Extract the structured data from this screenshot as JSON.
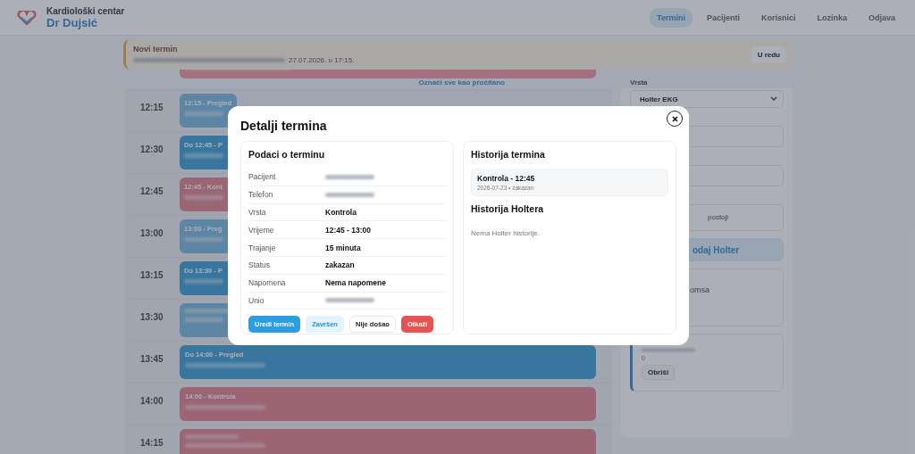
{
  "header": {
    "title": "Kardiološki centar",
    "subtitle": "Dr Dujsić",
    "nav": [
      {
        "label": "Termini",
        "selected": true
      },
      {
        "label": "Pacijenti",
        "selected": false
      },
      {
        "label": "Korisnici",
        "selected": false
      },
      {
        "label": "Lozinka",
        "selected": false
      },
      {
        "label": "Odjava",
        "selected": false
      }
    ]
  },
  "notification": {
    "title": "Novi termin",
    "message_tail": "27.07.2026. u 17:15.",
    "button": "U redu",
    "mark_all": "Označi sve kao pročitano"
  },
  "schedule": [
    {
      "time": "12:15",
      "kind": "pregled",
      "label": "12:15 - Pregled"
    },
    {
      "time": "12:30",
      "kind": "do",
      "label": "Do 12:45 - P"
    },
    {
      "time": "12:45",
      "kind": "kontrola",
      "label": "12:45 - Kont"
    },
    {
      "time": "13:00",
      "kind": "pregled",
      "label": "13:00 - Preg"
    },
    {
      "time": "13:15",
      "kind": "do",
      "label": "Do 13:30 - P"
    },
    {
      "time": "13:30",
      "kind": "pregled"
    },
    {
      "time": "13:45",
      "kind": "do",
      "label": "Do 14:00 - Pregled"
    },
    {
      "time": "14:00",
      "kind": "kontrola",
      "label": "14:00 - Kontrola"
    },
    {
      "time": "14:15",
      "kind": "kontrola"
    }
  ],
  "side_panel": {
    "type_label": "Vrsta",
    "type_value": "Holter EKG",
    "textarea_tail": "postoji",
    "add_button_tail": "odaj Holter",
    "card_tail": "omsa",
    "holter_count": "0",
    "delete_button": "Obriši"
  },
  "modal": {
    "title": "Detalji termina",
    "details": {
      "title": "Podaci o terminu",
      "rows": [
        {
          "label": "Pacijent"
        },
        {
          "label": "Telefon"
        },
        {
          "label": "Vrsta",
          "value": "Kontrola"
        },
        {
          "label": "Vrijeme",
          "value": "12:45 - 13:00"
        },
        {
          "label": "Trajanje",
          "value": "15 minuta"
        },
        {
          "label": "Status",
          "value": "zakazan"
        },
        {
          "label": "Napomena",
          "value": "Nema napomene"
        },
        {
          "label": "Unio"
        }
      ],
      "buttons": [
        {
          "label": "Uredi termin",
          "kind": "primary"
        },
        {
          "label": "Završen",
          "kind": "soft"
        },
        {
          "label": "Nije došao",
          "kind": "outline"
        },
        {
          "label": "Otkaži",
          "kind": "danger"
        }
      ]
    },
    "history": {
      "title": "Historija termina",
      "items": [
        {
          "title": "Kontrola - 12:45",
          "meta": "2026-07-23 • zakazan"
        }
      ],
      "holter_title": "Historija Holtera",
      "holter_empty": "Nema Holter historije."
    }
  }
}
